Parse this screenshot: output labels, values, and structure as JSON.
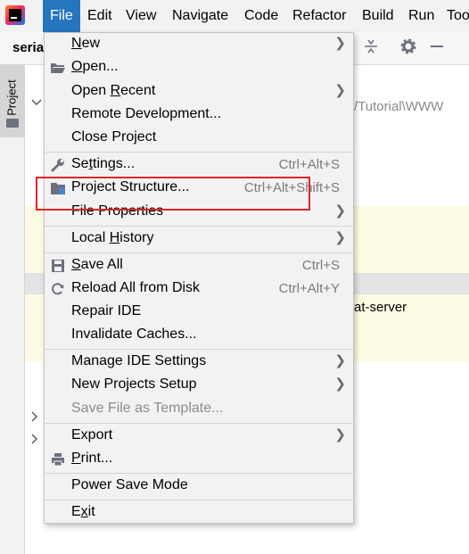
{
  "menubar": {
    "items": [
      "File",
      "Edit",
      "View",
      "Navigate",
      "Code",
      "Refactor",
      "Build",
      "Run",
      "Too"
    ],
    "active": "File"
  },
  "tab": {
    "label": "seria"
  },
  "left_strip": {
    "project_label": "Project"
  },
  "editor": {
    "path_fragment": "/Tutorial\\WWW",
    "server_fragment": "at-server"
  },
  "file_menu": {
    "items": [
      {
        "label": "New",
        "mnemonic": "N",
        "rest": "ew",
        "shortcut": "",
        "submenu": true,
        "icon": ""
      },
      {
        "label": "Open...",
        "mnemonic": "O",
        "rest": "pen...",
        "shortcut": "",
        "submenu": false,
        "icon": "folder-open-icon"
      },
      {
        "label": "Open Recent",
        "pre": "Open ",
        "mnemonic": "R",
        "rest": "ecent",
        "shortcut": "",
        "submenu": true,
        "icon": ""
      },
      {
        "label": "Remote Development...",
        "shortcut": "",
        "submenu": false,
        "icon": ""
      },
      {
        "label": "Close Project",
        "shortcut": "",
        "submenu": false,
        "icon": ""
      },
      {
        "label": "Settings...",
        "pre": "Se",
        "mnemonic": "t",
        "rest": "tings...",
        "shortcut": "Ctrl+Alt+S",
        "submenu": false,
        "icon": "wrench-icon"
      },
      {
        "label": "Project Structure...",
        "shortcut": "Ctrl+Alt+Shift+S",
        "submenu": false,
        "icon": "project-structure-icon"
      },
      {
        "label": "File Properties",
        "shortcut": "",
        "submenu": true,
        "icon": ""
      },
      {
        "label": "Local History",
        "pre": "Local ",
        "mnemonic": "H",
        "rest": "istory",
        "shortcut": "",
        "submenu": true,
        "icon": ""
      },
      {
        "label": "Save All",
        "mnemonic": "S",
        "rest": "ave All",
        "shortcut": "Ctrl+S",
        "submenu": false,
        "icon": "save-icon"
      },
      {
        "label": "Reload All from Disk",
        "shortcut": "Ctrl+Alt+Y",
        "submenu": false,
        "icon": "reload-icon"
      },
      {
        "label": "Repair IDE",
        "shortcut": "",
        "submenu": false,
        "icon": ""
      },
      {
        "label": "Invalidate Caches...",
        "shortcut": "",
        "submenu": false,
        "icon": ""
      },
      {
        "label": "Manage IDE Settings",
        "shortcut": "",
        "submenu": true,
        "icon": ""
      },
      {
        "label": "New Projects Setup",
        "shortcut": "",
        "submenu": true,
        "icon": ""
      },
      {
        "label": "Save File as Template...",
        "shortcut": "",
        "submenu": false,
        "icon": "",
        "disabled": true
      },
      {
        "label": "Export",
        "shortcut": "",
        "submenu": true,
        "icon": ""
      },
      {
        "label": "Print...",
        "mnemonic": "P",
        "rest": "rint...",
        "shortcut": "",
        "submenu": false,
        "icon": "print-icon"
      },
      {
        "label": "Power Save Mode",
        "shortcut": "",
        "submenu": false,
        "icon": ""
      },
      {
        "label": "Exit",
        "pre": "E",
        "mnemonic": "x",
        "rest": "it",
        "shortcut": "",
        "submenu": false,
        "icon": ""
      }
    ]
  },
  "colors": {
    "menubar_active": "#2675bf",
    "highlight_border": "#e0252b",
    "menu_bg": "#f2f2f2",
    "editor_band": "#fdfbe3"
  }
}
